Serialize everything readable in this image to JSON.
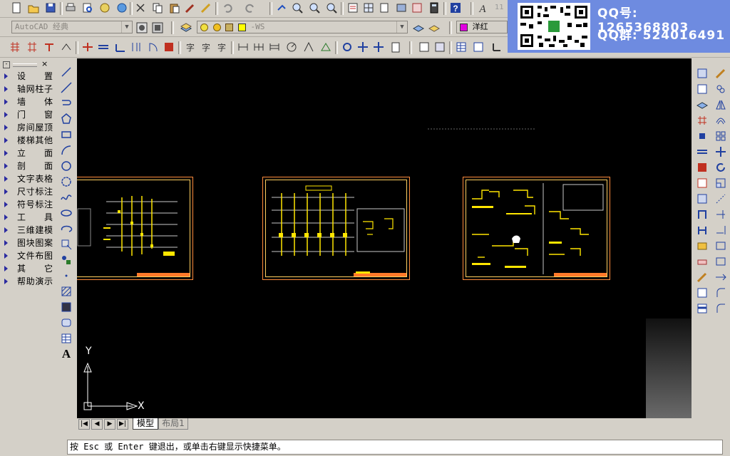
{
  "app": {
    "workspace": "AutoCAD 经典",
    "layer_name": "-WS",
    "color_name": "洋红",
    "color_swatch": "#e000e0",
    "zoom_label": "11"
  },
  "banner": {
    "qq_line": "QQ号: 1265368803",
    "group_line": "QQ群: 524016491",
    "bg": "#6e8be0"
  },
  "left_menu": {
    "items": [
      {
        "label": "设置",
        "icon": "triangle-right-icon"
      },
      {
        "label": "轴网柱子",
        "icon": "triangle-right-icon"
      },
      {
        "label": "墙体",
        "icon": "triangle-right-icon"
      },
      {
        "label": "门窗",
        "icon": "triangle-right-icon"
      },
      {
        "label": "房间屋顶",
        "icon": "triangle-right-icon"
      },
      {
        "label": "楼梯其他",
        "icon": "triangle-right-icon"
      },
      {
        "label": "立面",
        "icon": "triangle-right-icon"
      },
      {
        "label": "剖面",
        "icon": "triangle-right-icon"
      },
      {
        "label": "文字表格",
        "icon": "triangle-right-icon"
      },
      {
        "label": "尺寸标注",
        "icon": "triangle-right-icon"
      },
      {
        "label": "符号标注",
        "icon": "triangle-right-icon"
      },
      {
        "label": "工具",
        "icon": "triangle-right-icon"
      },
      {
        "label": "三维建模",
        "icon": "triangle-right-icon"
      },
      {
        "label": "图块图案",
        "icon": "triangle-right-icon"
      },
      {
        "label": "文件布图",
        "icon": "triangle-right-icon"
      },
      {
        "label": "其它",
        "icon": "triangle-right-icon"
      },
      {
        "label": "帮助演示",
        "icon": "triangle-right-icon"
      }
    ]
  },
  "draw_toolbar": {
    "text_tool_label": "A"
  },
  "canvas": {
    "background": "#000000",
    "ucs_x_label": "X",
    "ucs_y_label": "Y"
  },
  "tabs": {
    "model": "模型",
    "layout": "布局1"
  },
  "command_line": {
    "prompt": "按 Esc 或 Enter 键退出，或单击右键显示快捷菜单。"
  }
}
